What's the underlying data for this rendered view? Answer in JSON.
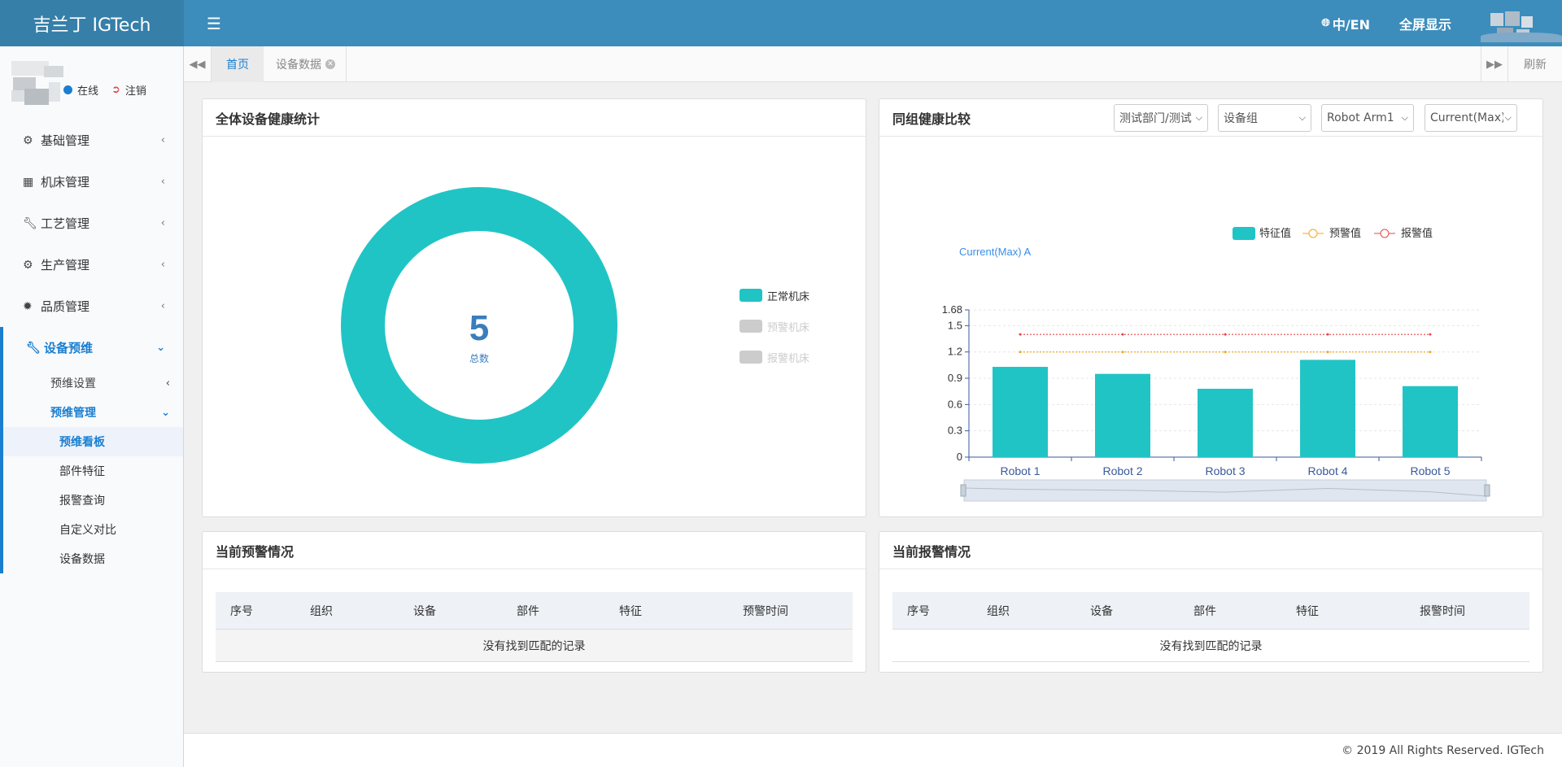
{
  "app": {
    "title": "吉兰丁 IGTech"
  },
  "header": {
    "lang_label": "中/EN",
    "fullscreen_label": "全屏显示"
  },
  "user": {
    "status_label": "在线",
    "logout_label": "注销"
  },
  "sidebar": {
    "items": [
      {
        "label": "基础管理"
      },
      {
        "label": "机床管理"
      },
      {
        "label": "工艺管理"
      },
      {
        "label": "生产管理"
      },
      {
        "label": "品质管理"
      },
      {
        "label": "设备预维"
      }
    ],
    "sub_items": [
      {
        "label": "预维设置"
      },
      {
        "label": "预维管理"
      }
    ],
    "leaves": [
      {
        "label": "预维看板"
      },
      {
        "label": "部件特征"
      },
      {
        "label": "报警查询"
      },
      {
        "label": "自定义对比"
      },
      {
        "label": "设备数据"
      }
    ]
  },
  "tabs": {
    "home": "首页",
    "device_data": "设备数据",
    "refresh": "刷新"
  },
  "health_panel": {
    "title": "全体设备健康统计",
    "total_value": "5",
    "total_label": "总数",
    "legend": [
      "正常机床",
      "预警机床",
      "报警机床"
    ],
    "colors": {
      "normal": "#21c4c5",
      "inactive": "#cccccc"
    }
  },
  "compare_panel": {
    "title": "同组健康比较",
    "selects": [
      "测试部门/测试",
      "设备组",
      "Robot Arm1",
      "Current(Max)"
    ]
  },
  "chart_data": {
    "type": "bar",
    "ylabel": "Current(Max) A",
    "ylim": [
      0,
      1.68
    ],
    "yticks": [
      "0",
      "0.3",
      "0.6",
      "0.9",
      "1.2",
      "1.5",
      "1.68"
    ],
    "categories": [
      "Robot 1",
      "Robot 2",
      "Robot 3",
      "Robot 4",
      "Robot 5"
    ],
    "series": [
      {
        "name": "特征值",
        "type": "bar",
        "color": "#21c4c5",
        "values": [
          1.03,
          0.95,
          0.78,
          1.11,
          0.81
        ]
      },
      {
        "name": "预警值",
        "type": "line",
        "color": "#f5a623",
        "values": [
          1.2,
          1.2,
          1.2,
          1.2,
          1.2
        ]
      },
      {
        "name": "报警值",
        "type": "line",
        "color": "#e8464a",
        "values": [
          1.4,
          1.4,
          1.4,
          1.4,
          1.4
        ]
      }
    ],
    "legend_position": "top-right"
  },
  "warning_panel": {
    "title": "当前预警情况",
    "columns": [
      "序号",
      "组织",
      "设备",
      "部件",
      "特征",
      "预警时间"
    ],
    "empty_text": "没有找到匹配的记录"
  },
  "alarm_panel": {
    "title": "当前报警情况",
    "columns": [
      "序号",
      "组织",
      "设备",
      "部件",
      "特征",
      "报警时间"
    ],
    "empty_text": "没有找到匹配的记录"
  },
  "footer": {
    "text": "© 2019 All Rights Reserved. IGTech"
  }
}
